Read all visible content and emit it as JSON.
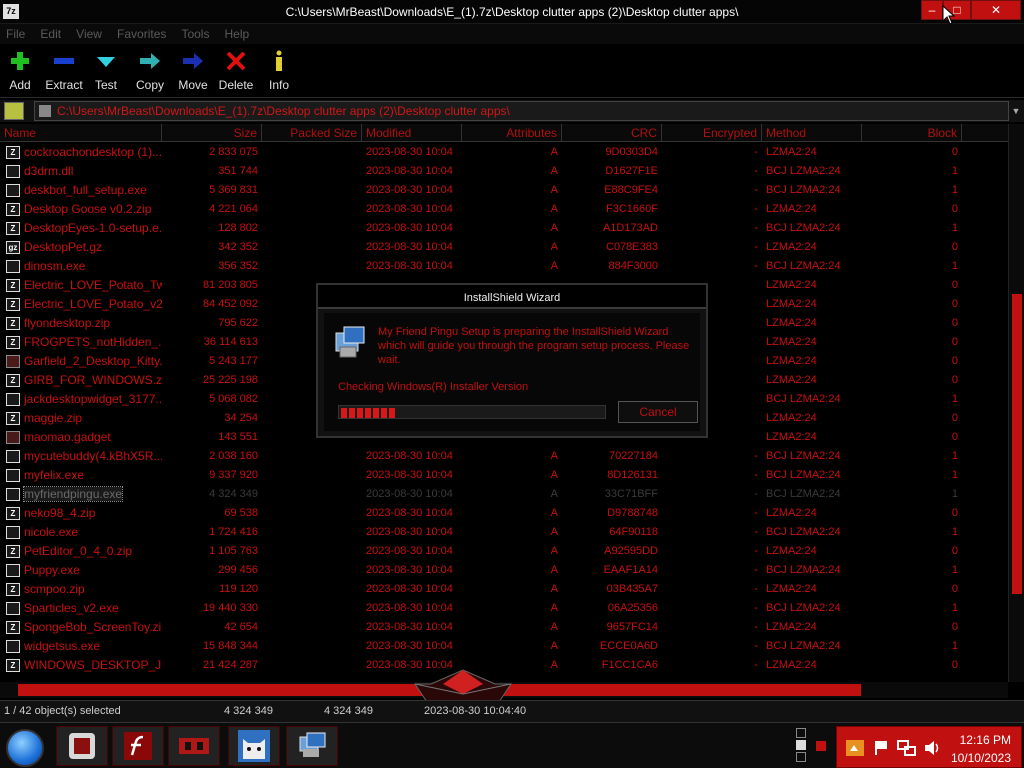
{
  "titlebar": {
    "title": "C:\\Users\\MrBeast\\Downloads\\E_(1).7z\\Desktop clutter apps (2)\\Desktop clutter apps\\",
    "app_icon": "7z",
    "min": "–",
    "max": "□",
    "close": "✕"
  },
  "menu": [
    "File",
    "Edit",
    "View",
    "Favorites",
    "Tools",
    "Help"
  ],
  "toolbar": [
    {
      "label": "Add",
      "icon": "plus-icon"
    },
    {
      "label": "Extract",
      "icon": "minus-icon"
    },
    {
      "label": "Test",
      "icon": "check-icon"
    },
    {
      "label": "Copy",
      "icon": "copy-arrow-icon"
    },
    {
      "label": "Move",
      "icon": "move-arrow-icon"
    },
    {
      "label": "Delete",
      "icon": "x-icon"
    },
    {
      "label": "Info",
      "icon": "info-icon"
    }
  ],
  "address": {
    "path": "C:\\Users\\MrBeast\\Downloads\\E_(1).7z\\Desktop clutter apps (2)\\Desktop clutter apps\\"
  },
  "columns": {
    "name": "Name",
    "size": "Size",
    "packed": "Packed Size",
    "modified": "Modified",
    "attributes": "Attributes",
    "crc": "CRC",
    "encrypted": "Encrypted",
    "method": "Method",
    "block": "Block"
  },
  "files": [
    {
      "name": "cockroachondesktop (1)...",
      "size": "2 833 075",
      "mod": "2023-08-30 10:04",
      "attr": "A",
      "crc": "9D0303D4",
      "enc": "-",
      "method": "LZMA2:24",
      "block": "0",
      "icon": "Z"
    },
    {
      "name": "d3drm.dll",
      "size": "351 744",
      "mod": "2023-08-30 10:04",
      "attr": "A",
      "crc": "D1627F1E",
      "enc": "-",
      "method": "BCJ LZMA2:24",
      "block": "1",
      "icon": "dll"
    },
    {
      "name": "deskbot_full_setup.exe",
      "size": "5 369 831",
      "mod": "2023-08-30 10:04",
      "attr": "A",
      "crc": "E88C9FE4",
      "enc": "-",
      "method": "BCJ LZMA2:24",
      "block": "1",
      "icon": "exe"
    },
    {
      "name": "Desktop Goose v0.2.zip",
      "size": "4 221 064",
      "mod": "2023-08-30 10:04",
      "attr": "A",
      "crc": "F3C1660F",
      "enc": "-",
      "method": "LZMA2:24",
      "block": "0",
      "icon": "Z"
    },
    {
      "name": "DesktopEyes-1.0-setup.e...",
      "size": "128 802",
      "mod": "2023-08-30 10:04",
      "attr": "A",
      "crc": "A1D173AD",
      "enc": "-",
      "method": "BCJ LZMA2:24",
      "block": "1",
      "icon": "Z"
    },
    {
      "name": "DesktopPet.gz",
      "size": "342 352",
      "mod": "2023-08-30 10:04",
      "attr": "A",
      "crc": "C078E383",
      "enc": "-",
      "method": "LZMA2:24",
      "block": "0",
      "icon": "gz"
    },
    {
      "name": "dinosm.exe",
      "size": "356 352",
      "mod": "2023-08-30 10:04",
      "attr": "A",
      "crc": "884F3000",
      "enc": "-",
      "method": "BCJ LZMA2:24",
      "block": "1",
      "icon": "exe"
    },
    {
      "name": "Electric_LOVE_Potato_Tw...",
      "size": "81 203 805",
      "mod": "",
      "attr": "",
      "crc": "",
      "enc": "",
      "method": "LZMA2:24",
      "block": "0",
      "icon": "Z"
    },
    {
      "name": "Electric_LOVE_Potato_v2...",
      "size": "84 452 092",
      "mod": "",
      "attr": "",
      "crc": "",
      "enc": "",
      "method": "LZMA2:24",
      "block": "0",
      "icon": "Z"
    },
    {
      "name": "flyondesktop.zip",
      "size": "795 622",
      "mod": "",
      "attr": "",
      "crc": "",
      "enc": "",
      "method": "LZMA2:24",
      "block": "0",
      "icon": "Z"
    },
    {
      "name": "FROGPETS_notHidden_...",
      "size": "36 114 613",
      "mod": "",
      "attr": "",
      "crc": "",
      "enc": "",
      "method": "LZMA2:24",
      "block": "0",
      "icon": "Z"
    },
    {
      "name": "Garfield_2_Desktop_Kitty...",
      "size": "5 243 177",
      "mod": "",
      "attr": "",
      "crc": "",
      "enc": "",
      "method": "LZMA2:24",
      "block": "0",
      "icon": "pen"
    },
    {
      "name": "GIRB_FOR_WINDOWS.zip",
      "size": "25 225 198",
      "mod": "",
      "attr": "",
      "crc": "",
      "enc": "",
      "method": "LZMA2:24",
      "block": "0",
      "icon": "Z"
    },
    {
      "name": "jackdesktopwidget_3177...",
      "size": "5 068 082",
      "mod": "",
      "attr": "",
      "crc": "",
      "enc": "",
      "method": "BCJ LZMA2:24",
      "block": "1",
      "icon": "exe"
    },
    {
      "name": "maggie.zip",
      "size": "34 254",
      "mod": "",
      "attr": "",
      "crc": "",
      "enc": "",
      "method": "LZMA2:24",
      "block": "0",
      "icon": "Z"
    },
    {
      "name": "maomao.gadget",
      "size": "143 551",
      "mod": "",
      "attr": "",
      "crc": "",
      "enc": "",
      "method": "LZMA2:24",
      "block": "0",
      "icon": "pen"
    },
    {
      "name": "mycutebuddy(4.kBhX5R...",
      "size": "2 038 160",
      "mod": "2023-08-30 10:04",
      "attr": "A",
      "crc": "70227184",
      "enc": "-",
      "method": "BCJ LZMA2:24",
      "block": "1",
      "icon": "exe"
    },
    {
      "name": "myfelix.exe",
      "size": "9 337 920",
      "mod": "2023-08-30 10:04",
      "attr": "A",
      "crc": "8D126131",
      "enc": "-",
      "method": "BCJ LZMA2:24",
      "block": "1",
      "icon": "exe"
    },
    {
      "name": "myfriendpingu.exe",
      "size": "4 324 349",
      "mod": "2023-08-30 10:04",
      "attr": "A",
      "crc": "33C71BFF",
      "enc": "-",
      "method": "BCJ LZMA2:24",
      "block": "1",
      "icon": "exe",
      "selected": true
    },
    {
      "name": "neko98_4.zip",
      "size": "69 538",
      "mod": "2023-08-30 10:04",
      "attr": "A",
      "crc": "D9788748",
      "enc": "-",
      "method": "LZMA2:24",
      "block": "0",
      "icon": "Z"
    },
    {
      "name": "nicole.exe",
      "size": "1 724 416",
      "mod": "2023-08-30 10:04",
      "attr": "A",
      "crc": "64F90118",
      "enc": "-",
      "method": "BCJ LZMA2:24",
      "block": "1",
      "icon": "exe"
    },
    {
      "name": "PetEditor_0_4_0.zip",
      "size": "1 105 763",
      "mod": "2023-08-30 10:04",
      "attr": "A",
      "crc": "A92595DD",
      "enc": "-",
      "method": "LZMA2:24",
      "block": "0",
      "icon": "Z"
    },
    {
      "name": "Puppy.exe",
      "size": "299 456",
      "mod": "2023-08-30 10:04",
      "attr": "A",
      "crc": "EAAF1A14",
      "enc": "-",
      "method": "BCJ LZMA2:24",
      "block": "1",
      "icon": "exe"
    },
    {
      "name": "scmpoo.zip",
      "size": "119 120",
      "mod": "2023-08-30 10:04",
      "attr": "A",
      "crc": "03B435A7",
      "enc": "-",
      "method": "LZMA2:24",
      "block": "0",
      "icon": "Z"
    },
    {
      "name": "Sparticles_v2.exe",
      "size": "19 440 330",
      "mod": "2023-08-30 10:04",
      "attr": "A",
      "crc": "06A25356",
      "enc": "-",
      "method": "BCJ LZMA2:24",
      "block": "1",
      "icon": "exe"
    },
    {
      "name": "SpongeBob_ScreenToy.zip",
      "size": "42 654",
      "mod": "2023-08-30 10:04",
      "attr": "A",
      "crc": "9657FC14",
      "enc": "-",
      "method": "LZMA2:24",
      "block": "0",
      "icon": "Z"
    },
    {
      "name": "widgetsus.exe",
      "size": "15 848 344",
      "mod": "2023-08-30 10:04",
      "attr": "A",
      "crc": "ECCE0A6D",
      "enc": "-",
      "method": "BCJ LZMA2:24",
      "block": "1",
      "icon": "exe"
    },
    {
      "name": "WINDOWS_DESKTOP_J...",
      "size": "21 424 287",
      "mod": "2023-08-30 10:04",
      "attr": "A",
      "crc": "F1CC1CA6",
      "enc": "-",
      "method": "LZMA2:24",
      "block": "0",
      "icon": "Z"
    }
  ],
  "status": {
    "selected": "1 / 42 object(s) selected",
    "size": "4 324 349",
    "packed": "4 324 349",
    "modified": "2023-08-30 10:04:40"
  },
  "dialog": {
    "title": "InstallShield Wizard",
    "message": "My Friend Pingu Setup is preparing the InstallShield Wizard which will guide you through the program setup process.  Please wait.",
    "status": "Checking Windows(R) Installer Version",
    "progress": 0.2,
    "cancel": "Cancel"
  },
  "taskbar": {
    "apps": [
      "blender-like-icon",
      "flash-icon",
      "red-app-icon",
      "cat-icon",
      "installer-icon"
    ]
  },
  "clock": {
    "time": "12:16 PM",
    "date": "10/10/2023"
  },
  "colors": {
    "accent": "#c01010",
    "background": "#000000"
  }
}
